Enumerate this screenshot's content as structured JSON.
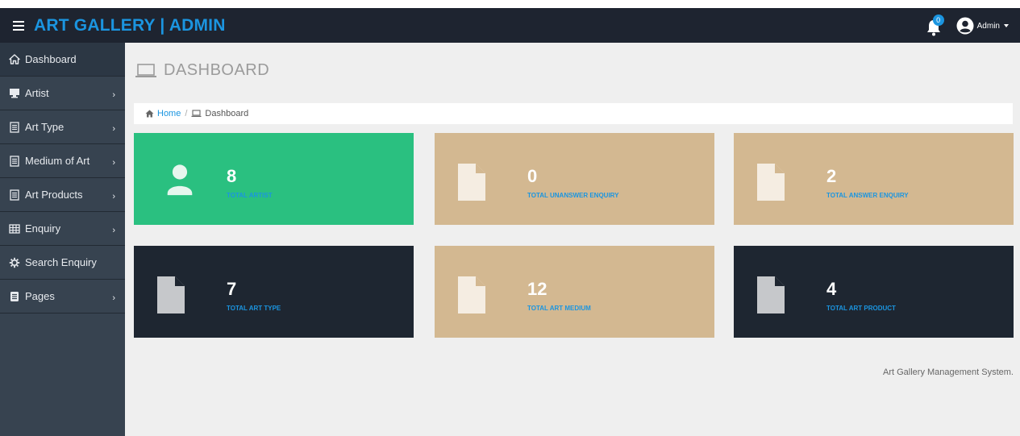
{
  "brand": "ART GALLERY | ADMIN",
  "header": {
    "notification_count": "0",
    "user_label": "Admin"
  },
  "sidebar": {
    "items": [
      {
        "label": "Dashboard"
      },
      {
        "label": "Artist"
      },
      {
        "label": "Art Type"
      },
      {
        "label": "Medium of Art"
      },
      {
        "label": "Art Products"
      },
      {
        "label": "Enquiry"
      },
      {
        "label": "Search Enquiry"
      },
      {
        "label": "Pages"
      }
    ]
  },
  "page": {
    "title": "DASHBOARD",
    "breadcrumb_home": "Home",
    "breadcrumb_current": "Dashboard"
  },
  "cards": [
    {
      "value": "8",
      "label": "TOTAL ARTIST"
    },
    {
      "value": "0",
      "label": "TOTAL UNANSWER ENQUIRY"
    },
    {
      "value": "2",
      "label": "TOTAL ANSWER ENQUIRY"
    },
    {
      "value": "7",
      "label": "TOTAL ART TYPE"
    },
    {
      "value": "12",
      "label": "TOTAL ART MEDIUM"
    },
    {
      "value": "4",
      "label": "TOTAL ART PRODUCT"
    }
  ],
  "footer": "Art Gallery Management System.",
  "colors": {
    "topbar": "#1e2430",
    "brand": "#1b95e0",
    "sidebar": "#374350",
    "card_green": "#2ac080",
    "card_tan": "#d3b891",
    "card_dark": "#1e2631"
  }
}
